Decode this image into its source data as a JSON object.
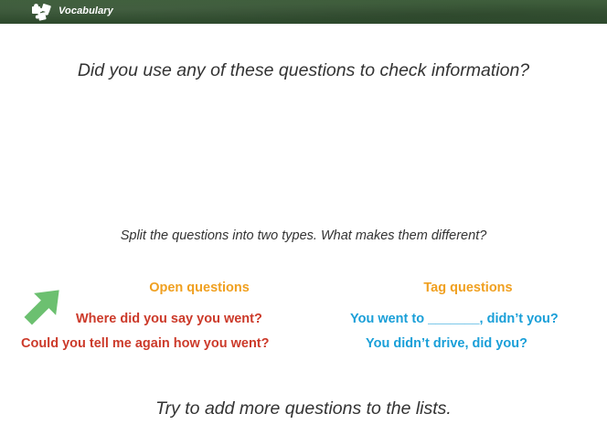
{
  "header": {
    "title": "Vocabulary",
    "icon": "puzzle-piece-icon",
    "background_color": "#355233"
  },
  "main": {
    "question": "Did you use any of these questions to check information?",
    "instruction": "Split the questions into two types. What makes them different?",
    "closing": "Try to add more questions to the lists.",
    "arrow_icon": "green-arrow-icon"
  },
  "open_questions": {
    "heading": "Open questions",
    "items": [
      "Where did you say you went?",
      "Could you tell me again how you went?"
    ]
  },
  "tag_questions": {
    "heading": "Tag questions",
    "items": [
      "You went to _______, didn’t you?",
      "You didn’t drive, did you?"
    ]
  },
  "colors": {
    "heading_orange": "#f0a020",
    "open_red": "#cc3a2a",
    "tag_blue": "#1a9fd8",
    "arrow_green": "#6cc070"
  }
}
